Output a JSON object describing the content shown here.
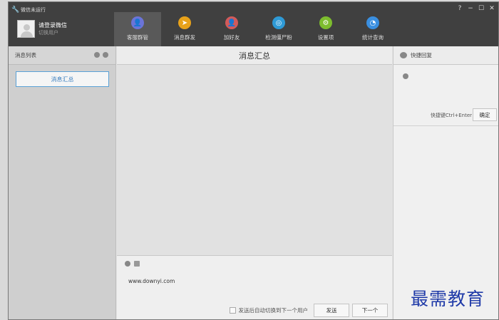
{
  "app": {
    "status_title": "微信未运行",
    "window_controls": [
      "?",
      "−",
      "☐",
      "✕"
    ]
  },
  "user": {
    "name": "请登录微信",
    "switch_label": "切换用户"
  },
  "nav": [
    {
      "label": "客服群管",
      "icon": "user-icon",
      "color": "#6b74d8",
      "glyph": "👤",
      "active": true
    },
    {
      "label": "消息群发",
      "icon": "send-icon",
      "color": "#e8a21a",
      "glyph": "➤",
      "active": false
    },
    {
      "label": "加好友",
      "icon": "add-friend-icon",
      "color": "#d25a5a",
      "glyph": "👤",
      "active": false
    },
    {
      "label": "检测僵尸粉",
      "icon": "detect-icon",
      "color": "#2e9ad6",
      "glyph": "◎",
      "active": false
    },
    {
      "label": "设置项",
      "icon": "settings-icon",
      "color": "#7dbd2e",
      "glyph": "⚙",
      "active": false
    },
    {
      "label": "统计查询",
      "icon": "stats-icon",
      "color": "#3a8fe0",
      "glyph": "◔",
      "active": false
    }
  ],
  "sidebar": {
    "title": "消息列表",
    "summary_button": "消息汇总"
  },
  "center": {
    "title": "消息汇总",
    "compose_text": "www.downyi.com",
    "auto_switch_label": "发送后自动切换到下一个用户",
    "send_button": "发送",
    "next_button": "下一个"
  },
  "right": {
    "title": "快捷回复",
    "shortcut_hint": "快捷键Ctrl+Enter",
    "ok_button": "确定"
  },
  "watermark": "最需教育"
}
